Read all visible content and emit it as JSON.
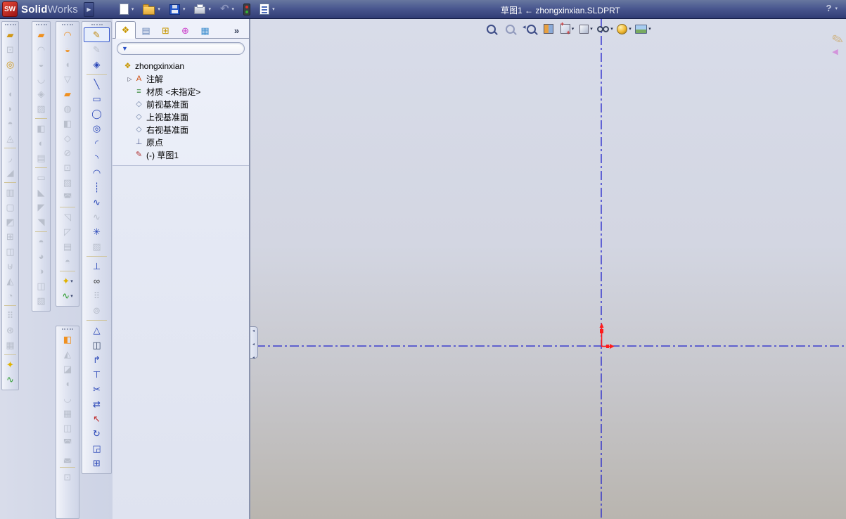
{
  "window": {
    "logo_text": "SW",
    "brand_bold": "Solid",
    "brand_light": "Works",
    "title": "草图1 ← zhongxinxian.SLDPRT",
    "help_label": "?"
  },
  "icons": {
    "dropdown": "▾",
    "expand": "▷",
    "brand_arrow": "▶",
    "funnel": "▼",
    "pencil": "✎",
    "cc_arrow": "◀"
  },
  "colors": {
    "titlebar_top": "#67779f",
    "titlebar_bottom": "#303c74",
    "centerline_blue": "#2222cc",
    "origin_red": "#ff1b1b",
    "disabled_icon": "#b9bfcc",
    "sketch_accent": "#2a47b8",
    "viewport_top": "#d8dce9",
    "viewport_bottom": "#b9b5af"
  },
  "standard_toolbar": {
    "items": [
      {
        "name": "new-document-button",
        "icon": "i-new",
        "dropdown": true
      },
      {
        "name": "open-button",
        "icon": "i-open",
        "dropdown": true
      },
      {
        "name": "save-button",
        "icon": "i-save",
        "dropdown": true
      },
      {
        "name": "print-button",
        "icon": "i-print",
        "dropdown": true
      },
      {
        "name": "undo-button",
        "icon": "i-undo",
        "dropdown": true
      },
      {
        "name": "performance-traffic-light-button",
        "icon": "i-traffic"
      },
      {
        "name": "options-checklist-button",
        "icon": "i-check",
        "dropdown": true
      }
    ]
  },
  "view_toolbar": {
    "items": [
      {
        "name": "zoom-to-fit-button",
        "icon": "i-lens"
      },
      {
        "name": "zoom-to-area-button",
        "icon": "i-lens dim"
      },
      {
        "name": "previous-view-button",
        "icon": "i-lensp"
      },
      {
        "name": "section-view-button",
        "icon": "i-section"
      },
      {
        "name": "view-orientation-button",
        "icon": "i-orient",
        "dropdown": true
      },
      {
        "name": "display-style-button",
        "icon": "i-cube",
        "dropdown": true
      },
      {
        "name": "hide-show-items-button",
        "icon": "i-glasses",
        "dropdown": true
      },
      {
        "name": "edit-appearance-button",
        "icon": "i-sphere",
        "dropdown": true
      },
      {
        "name": "apply-scene-button",
        "icon": "i-scene",
        "dropdown": true
      }
    ]
  },
  "feature_tree": {
    "tabs": [
      {
        "name": "tab-featuremanager",
        "glyph": "❖",
        "color": "#c79600",
        "active": true
      },
      {
        "name": "tab-propertymanager",
        "glyph": "▤",
        "color": "#6a87b8"
      },
      {
        "name": "tab-configurationmanager",
        "glyph": "⊞",
        "color": "#c79600"
      },
      {
        "name": "tab-dimxpertmanager",
        "glyph": "⊕",
        "color": "#cc44cc"
      },
      {
        "name": "tab-displaymanager",
        "glyph": "▦",
        "color": "#3f8fcf"
      },
      {
        "name": "tab-overflow",
        "glyph": "»",
        "color": "#333c55"
      }
    ],
    "items": [
      {
        "name": "tree-item-part",
        "glyph": "❖",
        "color": "#c79600",
        "label": "zhongxinxian",
        "indent": 0
      },
      {
        "name": "tree-item-annotations",
        "glyph": "A",
        "color": "#cc4400",
        "label": "注解",
        "indent": 1,
        "expand": true
      },
      {
        "name": "tree-item-material",
        "glyph": "≡",
        "color": "#3a8a3a",
        "label": "材质 <未指定>",
        "indent": 1
      },
      {
        "name": "tree-item-front-plane",
        "glyph": "◇",
        "color": "#7788aa",
        "label": "前视基准面",
        "indent": 1
      },
      {
        "name": "tree-item-top-plane",
        "glyph": "◇",
        "color": "#7788aa",
        "label": "上视基准面",
        "indent": 1
      },
      {
        "name": "tree-item-right-plane",
        "glyph": "◇",
        "color": "#7788aa",
        "label": "右视基准面",
        "indent": 1
      },
      {
        "name": "tree-item-origin",
        "glyph": "⊥",
        "color": "#44508a",
        "label": "原点",
        "indent": 1
      },
      {
        "name": "tree-item-sketch1",
        "glyph": "✎",
        "color": "#b03030",
        "label": "(-) 草图1",
        "indent": 1
      }
    ]
  },
  "toolbars": {
    "features": [
      {
        "name": "extruded-boss-button",
        "glyph": "▰",
        "color": "#d09818"
      },
      {
        "name": "extruded-cut-button",
        "glyph": "⊡",
        "disabled": true
      },
      {
        "name": "revolved-boss-button",
        "glyph": "◎",
        "color": "#d09818"
      },
      {
        "name": "lofted-boss-button",
        "glyph": "◠",
        "disabled": true
      },
      {
        "name": "swept-boss-button",
        "glyph": "◖",
        "disabled": true
      },
      {
        "name": "boundary-boss-button",
        "glyph": "◗",
        "disabled": true
      },
      {
        "name": "dome-button",
        "glyph": "◓",
        "disabled": true
      },
      {
        "name": "wrap-button",
        "glyph": "◬",
        "disabled": true
      },
      {
        "sep": true
      },
      {
        "name": "fillet-button",
        "glyph": "◞",
        "disabled": true
      },
      {
        "name": "chamfer-button",
        "glyph": "◢",
        "disabled": true
      },
      {
        "sep": true
      },
      {
        "name": "rib-button",
        "glyph": "▥",
        "disabled": true
      },
      {
        "name": "shell-button",
        "glyph": "▢",
        "disabled": true
      },
      {
        "name": "draft-button",
        "glyph": "◩",
        "disabled": true
      },
      {
        "name": "hole-wizard-button",
        "glyph": "⊞",
        "disabled": true
      },
      {
        "name": "mirror-button",
        "glyph": "◫",
        "disabled": true
      },
      {
        "name": "combine-button",
        "glyph": "⊎",
        "disabled": true
      },
      {
        "name": "intersect-button",
        "glyph": "◭",
        "disabled": true
      },
      {
        "name": "split-button",
        "glyph": "◔",
        "disabled": true
      },
      {
        "sep": true
      },
      {
        "name": "linear-pattern-button",
        "glyph": "⠿",
        "disabled": true
      },
      {
        "name": "circular-pattern-button",
        "glyph": "⊛",
        "disabled": true
      },
      {
        "name": "move-copy-body-button",
        "glyph": "▦",
        "disabled": true
      },
      {
        "sep": true
      },
      {
        "name": "reference-geometry-button",
        "glyph": "✦",
        "color": "#e0b200"
      },
      {
        "name": "curves-button",
        "glyph": "∿",
        "color": "#2f9e2f"
      }
    ],
    "surfaces": [
      {
        "name": "extruded-surface-button",
        "glyph": "▰",
        "color": "#ef9020"
      },
      {
        "name": "swept-surface-button",
        "glyph": "◠",
        "disabled": true
      },
      {
        "name": "revolved-surface-button",
        "glyph": "◒",
        "disabled": true
      },
      {
        "name": "lofted-surface-button",
        "glyph": "◡",
        "disabled": true
      },
      {
        "name": "boundary-surface-button",
        "glyph": "◈",
        "disabled": true
      },
      {
        "name": "freeform-button",
        "glyph": "▨",
        "disabled": true
      },
      {
        "sep": true
      },
      {
        "name": "offset-surface-button",
        "glyph": "◧",
        "disabled": true
      },
      {
        "name": "radiate-surface-button",
        "glyph": "◐",
        "disabled": true
      },
      {
        "name": "knit-surface-button",
        "glyph": "▤",
        "disabled": true
      },
      {
        "sep": true
      },
      {
        "name": "planar-surface-button",
        "glyph": "▭",
        "disabled": true
      },
      {
        "name": "extend-surface-button",
        "glyph": "◣",
        "disabled": true
      },
      {
        "name": "trim-surface-button",
        "glyph": "◤",
        "disabled": true
      },
      {
        "name": "untrim-surface-button",
        "glyph": "◥",
        "disabled": true
      },
      {
        "sep": true
      },
      {
        "name": "thicken-button",
        "glyph": "◓",
        "disabled": true
      },
      {
        "name": "thickened-cut-button",
        "glyph": "◕",
        "disabled": true
      },
      {
        "name": "cut-with-surface-button",
        "glyph": "◑",
        "disabled": true
      },
      {
        "name": "mid-surface-button",
        "glyph": "◫",
        "disabled": true
      },
      {
        "name": "replace-face-button",
        "glyph": "▧",
        "disabled": true
      }
    ],
    "surfaces2": [
      {
        "name": "swept-surface-button",
        "glyph": "◠",
        "color": "#ef9020"
      },
      {
        "name": "revolved-surface-button",
        "glyph": "◒",
        "color": "#ef9020"
      },
      {
        "name": "lofted-surface-button",
        "glyph": "◖",
        "disabled": true
      },
      {
        "name": "boundary-surface-button",
        "glyph": "▽",
        "disabled": true
      },
      {
        "name": "planar-surface-button",
        "glyph": "▰",
        "color": "#ef9020"
      },
      {
        "name": "filled-surface-button",
        "glyph": "◍",
        "disabled": true
      },
      {
        "name": "offset-surface-button",
        "glyph": "◧",
        "disabled": true
      },
      {
        "name": "ruled-surface-button",
        "glyph": "◇",
        "disabled": true
      },
      {
        "name": "delete-face-button",
        "glyph": "⊘",
        "disabled": true
      },
      {
        "name": "replace-face-button",
        "glyph": "⊡",
        "disabled": true
      },
      {
        "name": "untrim-surface-button",
        "glyph": "▧",
        "disabled": true
      },
      {
        "name": "parting-surface-button",
        "glyph": "◚",
        "disabled": true
      },
      {
        "sep": true
      },
      {
        "name": "extend-surface-button",
        "glyph": "◹",
        "disabled": true
      },
      {
        "name": "trim-surface-button",
        "glyph": "◸",
        "disabled": true
      },
      {
        "name": "knit-surface-button",
        "glyph": "▤",
        "disabled": true
      },
      {
        "name": "thicken-button",
        "glyph": "◓",
        "disabled": true
      },
      {
        "sep": true
      },
      {
        "name": "reference-geometry-button",
        "glyph": "✦",
        "color": "#e0b200",
        "dropdown": true
      },
      {
        "name": "curves-button",
        "glyph": "∿",
        "color": "#2f9e2f",
        "dropdown": true
      }
    ],
    "mold": [
      {
        "name": "split-line-button",
        "glyph": "◧",
        "color": "#ef9020"
      },
      {
        "name": "draft-analysis-button",
        "glyph": "◭",
        "disabled": true
      },
      {
        "name": "undercut-analysis-button",
        "glyph": "◪",
        "disabled": true
      },
      {
        "name": "parting-lines-button",
        "glyph": "◖",
        "disabled": true
      },
      {
        "name": "shut-off-surfaces-button",
        "glyph": "◡",
        "disabled": true
      },
      {
        "name": "parting-surfaces-button",
        "glyph": "▦",
        "disabled": true
      },
      {
        "name": "tooling-split-button",
        "glyph": "◫",
        "disabled": true
      },
      {
        "name": "core-button",
        "glyph": "◚",
        "disabled": true
      },
      {
        "name": "cavity-button",
        "glyph": "◛",
        "disabled": true
      },
      {
        "sep": true
      },
      {
        "name": "mold-folder-button",
        "glyph": "⊡",
        "disabled": true
      }
    ],
    "sketch": [
      {
        "name": "sketch-button",
        "glyph": "✎",
        "color": "#c08a10",
        "active": true
      },
      {
        "name": "sketch-3d-button",
        "glyph": "✎",
        "disabled": true
      },
      {
        "name": "smart-dimension-button",
        "glyph": "◈",
        "color": "#2a47b8"
      },
      {
        "sep": true
      },
      {
        "name": "line-button",
        "glyph": "╲",
        "color": "#2a47b8"
      },
      {
        "name": "rectangle-button",
        "glyph": "▭",
        "color": "#2a47b8"
      },
      {
        "name": "circle-button",
        "glyph": "◯",
        "color": "#2a47b8"
      },
      {
        "name": "ellipse-button",
        "glyph": "◎",
        "color": "#2a47b8"
      },
      {
        "name": "centerpoint-arc-button",
        "glyph": "◜",
        "color": "#2a47b8"
      },
      {
        "name": "tangent-arc-button",
        "glyph": "◝",
        "color": "#2a47b8"
      },
      {
        "name": "three-point-arc-button",
        "glyph": "◠",
        "color": "#2a47b8"
      },
      {
        "name": "centerline-button",
        "glyph": "┊",
        "color": "#2a47b8"
      },
      {
        "name": "spline-button",
        "glyph": "∿",
        "color": "#2a47b8"
      },
      {
        "name": "spline-on-surface-button",
        "glyph": "∿",
        "disabled": true
      },
      {
        "name": "point-button",
        "glyph": "✳",
        "color": "#2a47b8"
      },
      {
        "name": "area-hatch-button",
        "glyph": "▨",
        "disabled": true
      },
      {
        "sep": true
      },
      {
        "name": "add-relation-button",
        "glyph": "⊥",
        "color": "#2a47b8"
      },
      {
        "name": "display-relations-button",
        "glyph": "∞",
        "color": "#444444"
      },
      {
        "name": "linear-sketch-pattern-button",
        "glyph": "⠿",
        "disabled": true
      },
      {
        "name": "circular-sketch-pattern-button",
        "glyph": "⊚",
        "disabled": true
      },
      {
        "sep": true
      },
      {
        "name": "check-sketch-button",
        "glyph": "△",
        "color": "#2a47b8"
      },
      {
        "name": "mirror-entities-button",
        "glyph": "◫",
        "color": "#334466"
      },
      {
        "name": "convert-entities-button",
        "glyph": "↱",
        "color": "#2a47b8"
      },
      {
        "name": "offset-entities-button",
        "glyph": "⊤",
        "color": "#2a47b8"
      },
      {
        "name": "trim-entities-button",
        "glyph": "✂",
        "color": "#2a47b8"
      },
      {
        "name": "extend-entities-button",
        "glyph": "⇄",
        "color": "#2a47b8"
      },
      {
        "name": "move-entities-button",
        "glyph": "↖",
        "color": "#c03030"
      },
      {
        "name": "rotate-entities-button",
        "glyph": "↻",
        "color": "#2a47b8"
      },
      {
        "name": "scale-entities-button",
        "glyph": "◲",
        "color": "#2a47b8"
      },
      {
        "name": "copy-entities-button",
        "glyph": "⊞",
        "color": "#2a47b8"
      }
    ]
  }
}
